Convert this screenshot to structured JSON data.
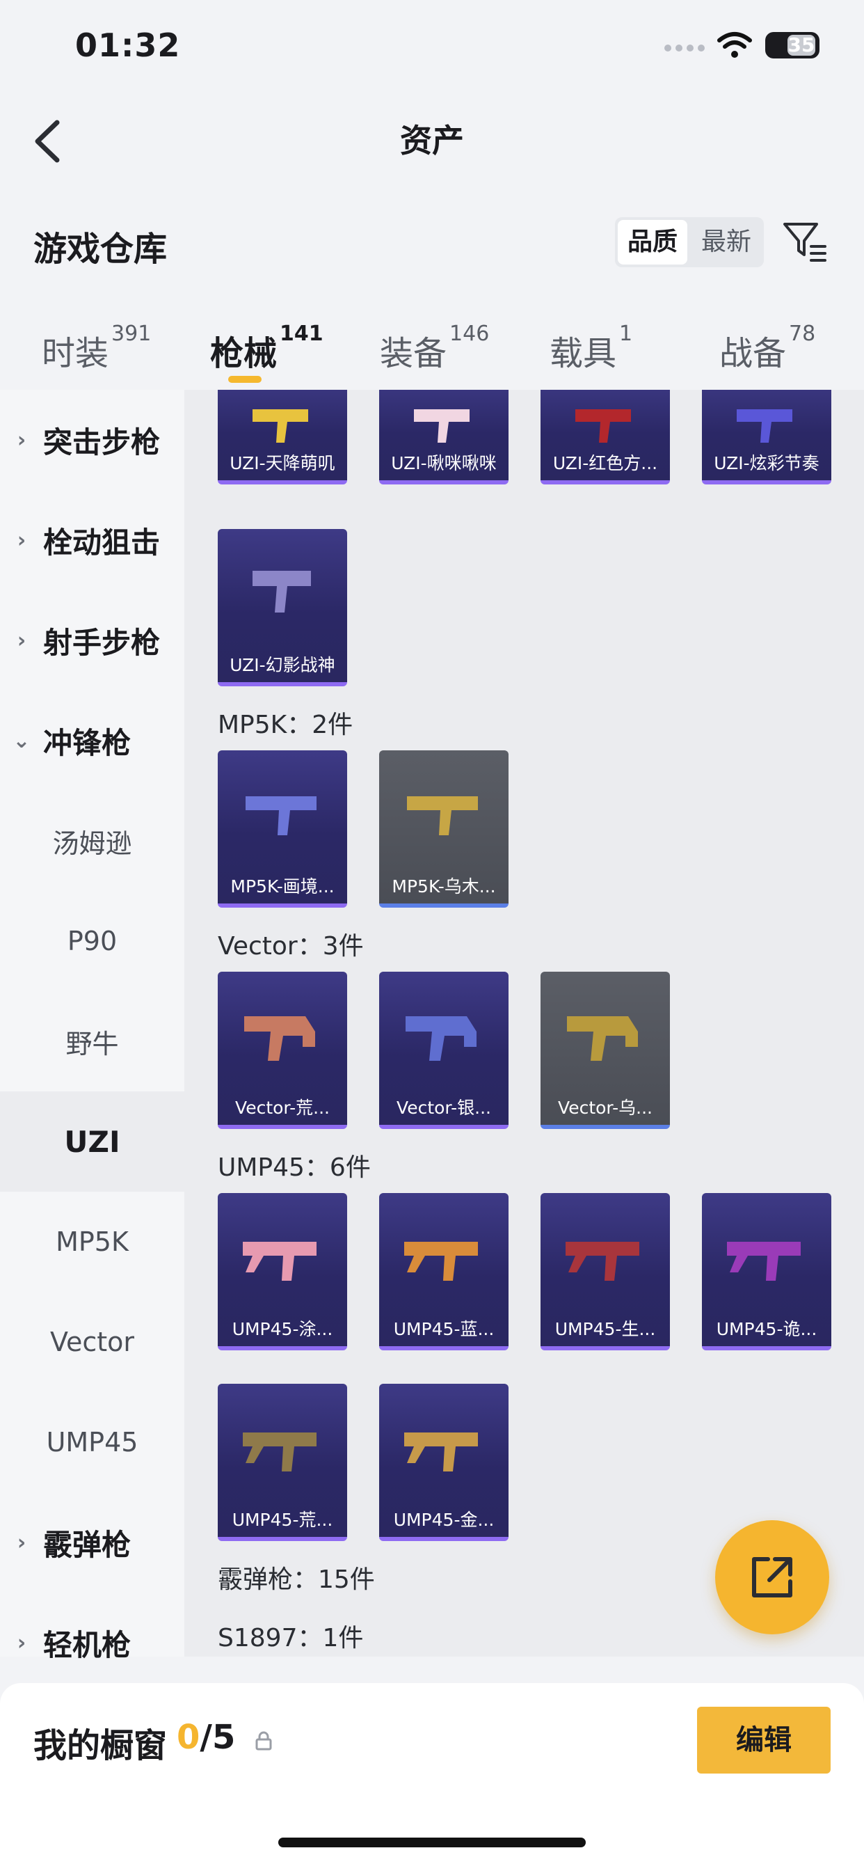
{
  "status_bar": {
    "time": "01:32",
    "battery": "35"
  },
  "nav": {
    "title": "资产"
  },
  "warehouse": {
    "title": "游戏仓库",
    "sort_options": [
      "品质",
      "最新"
    ],
    "active_sort": "品质"
  },
  "tabs": [
    {
      "label": "时装",
      "count": "391"
    },
    {
      "label": "枪械",
      "count": "141",
      "active": true
    },
    {
      "label": "装备",
      "count": "146"
    },
    {
      "label": "载具",
      "count": "1"
    },
    {
      "label": "战备",
      "count": "78"
    }
  ],
  "sidebar": {
    "items": [
      {
        "label": "突击步枪",
        "type": "group",
        "expanded": false
      },
      {
        "label": "栓动狙击",
        "type": "group",
        "expanded": false
      },
      {
        "label": "射手步枪",
        "type": "group",
        "expanded": false
      },
      {
        "label": "冲锋枪",
        "type": "group",
        "expanded": true
      },
      {
        "label": "汤姆逊",
        "type": "sub"
      },
      {
        "label": "P90",
        "type": "sub"
      },
      {
        "label": "野牛",
        "type": "sub"
      },
      {
        "label": "UZI",
        "type": "sub",
        "selected": true
      },
      {
        "label": "MP5K",
        "type": "sub"
      },
      {
        "label": "Vector",
        "type": "sub"
      },
      {
        "label": "UMP45",
        "type": "sub"
      },
      {
        "label": "霰弹枪",
        "type": "group",
        "expanded": false
      },
      {
        "label": "轻机枪",
        "type": "group",
        "expanded": false
      }
    ]
  },
  "content": {
    "uzi_cards": [
      {
        "label": "UZI-天降萌叽",
        "rarity": "purple"
      },
      {
        "label": "UZI-啾咪啾咪",
        "rarity": "purple"
      },
      {
        "label": "UZI-红色方...",
        "rarity": "purple"
      },
      {
        "label": "UZI-炫彩节奏",
        "rarity": "purple"
      },
      {
        "label": "UZI-幻影战神",
        "rarity": "purple"
      }
    ],
    "mp5k_header": "MP5K：2件",
    "mp5k_cards": [
      {
        "label": "MP5K-画境...",
        "rarity": "purple"
      },
      {
        "label": "MP5K-乌木...",
        "rarity": "gray"
      }
    ],
    "vector_header": "Vector：3件",
    "vector_cards": [
      {
        "label": "Vector-荒...",
        "rarity": "purple"
      },
      {
        "label": "Vector-银...",
        "rarity": "purple"
      },
      {
        "label": "Vector-乌...",
        "rarity": "gray"
      }
    ],
    "ump45_header": "UMP45：6件",
    "ump45_cards": [
      {
        "label": "UMP45-涂...",
        "rarity": "purple"
      },
      {
        "label": "UMP45-蓝...",
        "rarity": "purple"
      },
      {
        "label": "UMP45-生...",
        "rarity": "purple"
      },
      {
        "label": "UMP45-诡...",
        "rarity": "purple"
      },
      {
        "label": "UMP45-荒...",
        "rarity": "purple"
      },
      {
        "label": "UMP45-金...",
        "rarity": "purple"
      }
    ],
    "shotgun_header": "霰弹枪：15件",
    "s1897_header": "S1897：1件"
  },
  "showcase": {
    "title": "我的橱窗",
    "current": "0",
    "max": "/5",
    "edit_label": "编辑"
  },
  "icons": [
    "back-arrow-icon",
    "filter-icon",
    "share-icon",
    "lock-icon",
    "wifi-icon",
    "chevron-right-icon",
    "chevron-down-icon"
  ],
  "colors": {
    "accent": "#f5b52f",
    "purple_card": "#2b2866",
    "purple_border": "#8e6bf2",
    "gray_card": "#4a4d55",
    "gray_border": "#5b7fe6"
  }
}
